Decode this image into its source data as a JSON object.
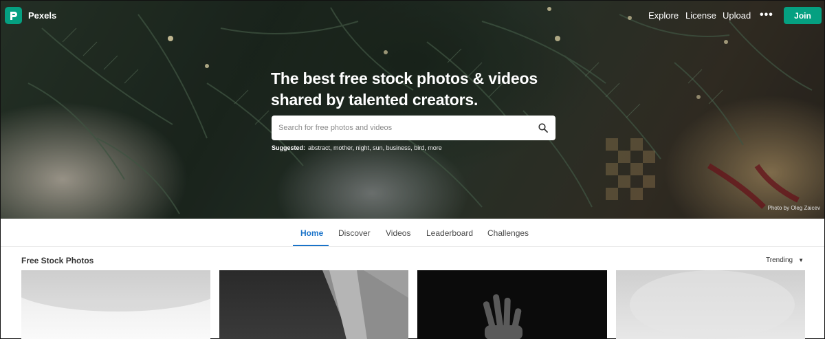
{
  "nav": {
    "logo_text": "Pexels",
    "links": [
      "Explore",
      "License",
      "Upload"
    ],
    "more_label": "•••",
    "join_label": "Join"
  },
  "hero": {
    "headline_line1": "The best free stock photos & videos",
    "headline_line2": "shared by talented creators.",
    "search_placeholder": "Search for free photos and videos",
    "suggested_label": "Suggested:",
    "suggested_items": [
      "abstract",
      "mother",
      "night",
      "sun",
      "business",
      "bird",
      "more"
    ],
    "credit": "Photo by Oleg Zaicev"
  },
  "tabs": [
    {
      "label": "Home",
      "active": true
    },
    {
      "label": "Discover",
      "active": false
    },
    {
      "label": "Videos",
      "active": false
    },
    {
      "label": "Leaderboard",
      "active": false
    },
    {
      "label": "Challenges",
      "active": false
    }
  ],
  "content": {
    "section_title": "Free Stock Photos",
    "sort_label": "Trending"
  },
  "colors": {
    "brand": "#05a081",
    "tab_active": "#1a73c9"
  }
}
